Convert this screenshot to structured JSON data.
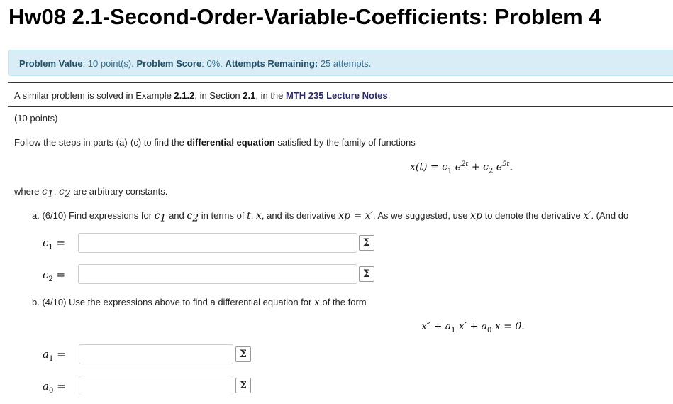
{
  "page": {
    "title": "Hw08 2.1-Second-Order-Variable-Coefficients: Problem 4"
  },
  "info": {
    "value_label": "Problem Value",
    "value_text": ": 10 point(s). ",
    "score_label": "Problem Score",
    "score_text": ": 0%. ",
    "attempts_label": "Attempts Remaining:",
    "attempts_text": " 25 attempts."
  },
  "problem": {
    "ref_pre": "A similar problem is solved in Example ",
    "ref_example": "2.1.2",
    "ref_mid": ", in Section ",
    "ref_section": "2.1",
    "ref_mid2": ", in the ",
    "ref_notes": "MTH 235 Lecture Notes",
    "ref_end": ".",
    "points": "(10 points)",
    "instr_pre": "Follow the steps in parts (a)-(c) to find the ",
    "instr_bold": "differential equation",
    "instr_post": " satisfied by the family of functions",
    "family_x": "x",
    "family_t": "(t) = c",
    "family_1": "1",
    "family_e1": " e",
    "family_exp1": "2t",
    "family_plus": " + c",
    "family_2": "2",
    "family_e2": " e",
    "family_exp2": "5t",
    "family_dot": ".",
    "where_pre": "where ",
    "where_c1": "c",
    "where_c1sub": "1",
    "where_comma": ", ",
    "where_c2": "c",
    "where_c2sub": "2",
    "where_post": " are arbitrary constants.",
    "part_a_pre": "a. (6/10) Find expressions for ",
    "part_a_c1": "c",
    "part_a_c1sub": "1",
    "part_a_and": " and ",
    "part_a_c2": "c",
    "part_a_c2sub": "2",
    "part_a_mid": " in terms of ",
    "part_a_t": "t",
    "part_a_comma": ", ",
    "part_a_x": "x",
    "part_a_mid2": ", and its derivative ",
    "part_a_xp": "xp = x′",
    "part_a_mid3": ". As we suggested, use ",
    "part_a_xp2": "xp",
    "part_a_mid4": " to denote the derivative ",
    "part_a_xprime": "x′",
    "part_a_end": ". (And do",
    "part_b_pre": "b. (4/10) Use the expressions above to find a differential equation for ",
    "part_b_x": "x",
    "part_b_post": " of the form",
    "ode_a": "x″ + a",
    "ode_1": "1",
    "ode_b": " x′ + a",
    "ode_0": "0",
    "ode_c": " x = 0."
  },
  "answers": {
    "c1_label": "c",
    "c1_sub": "1",
    "c2_label": "c",
    "c2_sub": "2",
    "a1_label": "a",
    "a1_sub": "1",
    "a0_label": "a",
    "a0_sub": "0",
    "eq": " =",
    "c1_value": "",
    "c2_value": "",
    "a1_value": "",
    "a0_value": ""
  },
  "icons": {
    "equation_editor_glyph": "Σ"
  },
  "colors": {
    "info_bg": "#d9edf7",
    "info_text": "#31708f"
  }
}
